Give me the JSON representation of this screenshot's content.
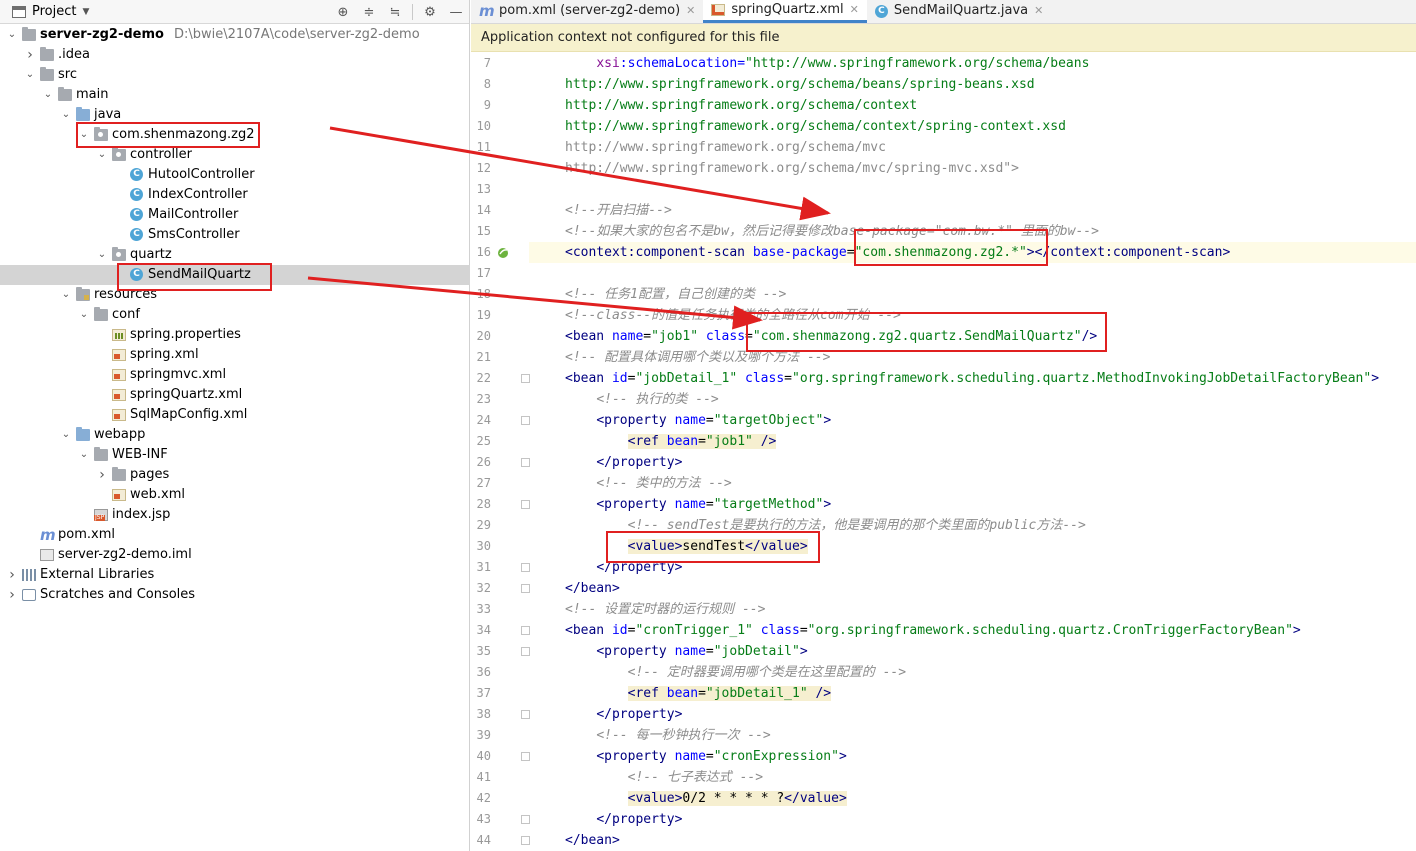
{
  "project_panel": {
    "title": "Project",
    "tools": [
      "target-icon",
      "collapse-icon",
      "expand-icon",
      "gear-icon",
      "hide-icon"
    ],
    "tree": [
      {
        "label": "server-zg2-demo",
        "path": "D:\\bwie\\2107A\\code\\server-zg2-demo",
        "indent": 0,
        "arrow": "down",
        "icon": "module",
        "bold": true
      },
      {
        "label": ".idea",
        "indent": 1,
        "arrow": "right",
        "icon": "folder"
      },
      {
        "label": "src",
        "indent": 1,
        "arrow": "down",
        "icon": "folder"
      },
      {
        "label": "main",
        "indent": 2,
        "arrow": "down",
        "icon": "folder"
      },
      {
        "label": "java",
        "indent": 3,
        "arrow": "down",
        "icon": "folder-blue"
      },
      {
        "label": "com.shenmazong.zg2",
        "indent": 4,
        "arrow": "down",
        "icon": "package"
      },
      {
        "label": "controller",
        "indent": 5,
        "arrow": "down",
        "icon": "package"
      },
      {
        "label": "HutoolController",
        "indent": 6,
        "arrow": "",
        "icon": "class"
      },
      {
        "label": "IndexController",
        "indent": 6,
        "arrow": "",
        "icon": "class"
      },
      {
        "label": "MailController",
        "indent": 6,
        "arrow": "",
        "icon": "class"
      },
      {
        "label": "SmsController",
        "indent": 6,
        "arrow": "",
        "icon": "class"
      },
      {
        "label": "quartz",
        "indent": 5,
        "arrow": "down",
        "icon": "package"
      },
      {
        "label": "SendMailQuartz",
        "indent": 6,
        "arrow": "",
        "icon": "class",
        "selected": true
      },
      {
        "label": "resources",
        "indent": 3,
        "arrow": "down",
        "icon": "folder-res"
      },
      {
        "label": "conf",
        "indent": 4,
        "arrow": "down",
        "icon": "folder"
      },
      {
        "label": "spring.properties",
        "indent": 5,
        "arrow": "",
        "icon": "props"
      },
      {
        "label": "spring.xml",
        "indent": 5,
        "arrow": "",
        "icon": "xml"
      },
      {
        "label": "springmvc.xml",
        "indent": 5,
        "arrow": "",
        "icon": "xml"
      },
      {
        "label": "springQuartz.xml",
        "indent": 5,
        "arrow": "",
        "icon": "xml"
      },
      {
        "label": "SqlMapConfig.xml",
        "indent": 5,
        "arrow": "",
        "icon": "xml"
      },
      {
        "label": "webapp",
        "indent": 3,
        "arrow": "down",
        "icon": "folder-blue"
      },
      {
        "label": "WEB-INF",
        "indent": 4,
        "arrow": "down",
        "icon": "folder"
      },
      {
        "label": "pages",
        "indent": 5,
        "arrow": "right",
        "icon": "folder"
      },
      {
        "label": "web.xml",
        "indent": 5,
        "arrow": "",
        "icon": "xml"
      },
      {
        "label": "index.jsp",
        "indent": 4,
        "arrow": "",
        "icon": "jsp"
      },
      {
        "label": "pom.xml",
        "indent": 1,
        "arrow": "",
        "icon": "maven"
      },
      {
        "label": "server-zg2-demo.iml",
        "indent": 1,
        "arrow": "",
        "icon": "iml"
      },
      {
        "label": "External Libraries",
        "indent": 0,
        "arrow": "right",
        "icon": "lib"
      },
      {
        "label": "Scratches and Consoles",
        "indent": 0,
        "arrow": "right",
        "icon": "scratch"
      }
    ]
  },
  "editor": {
    "tabs": [
      {
        "label": "pom.xml (server-zg2-demo)",
        "icon": "maven",
        "active": false
      },
      {
        "label": "springQuartz.xml",
        "icon": "xml",
        "active": true
      },
      {
        "label": "SendMailQuartz.java",
        "icon": "class",
        "active": false
      }
    ],
    "notice": "Application context not configured for this file",
    "current_line": 16,
    "lines": [
      {
        "n": 7,
        "tokens": [
          [
            "plain",
            "    "
          ],
          [
            "ns",
            "xsi"
          ],
          [
            "attr",
            ":schemaLocation="
          ],
          [
            "val",
            "\"http://www.springframework.org/schema/beans"
          ]
        ]
      },
      {
        "n": 8,
        "tokens": [
          [
            "url",
            "http://www.springframework.org/schema/beans/spring-beans.xsd"
          ]
        ]
      },
      {
        "n": 9,
        "tokens": [
          [
            "url",
            "http://www.springframework.org/schema/context"
          ]
        ]
      },
      {
        "n": 10,
        "tokens": [
          [
            "url",
            "http://www.springframework.org/schema/context/spring-context.xsd"
          ]
        ]
      },
      {
        "n": 11,
        "tokens": [
          [
            "gray",
            "http://www.springframework.org/schema/mvc"
          ]
        ]
      },
      {
        "n": 12,
        "tokens": [
          [
            "gray",
            "http://www.springframework.org/schema/mvc/spring-mvc.xsd\">"
          ]
        ]
      },
      {
        "n": 13,
        "tokens": []
      },
      {
        "n": 14,
        "tokens": [
          [
            "cm",
            "<!--开启扫描-->"
          ]
        ]
      },
      {
        "n": 15,
        "tokens": [
          [
            "cm",
            "<!--如果大家的包名不是bw，然后记得要修改base-package=\"com.bw.*\" 里面的bw-->"
          ]
        ]
      },
      {
        "n": 16,
        "tokens": [
          [
            "tag",
            "<context:component-scan "
          ],
          [
            "attr",
            "base-package"
          ],
          [
            "plain",
            "="
          ],
          [
            "val",
            "\"com.shenmazong.zg2.*\""
          ],
          [
            "tag",
            ">"
          ],
          [
            "tag",
            "</context:component-scan>"
          ]
        ]
      },
      {
        "n": 17,
        "tokens": []
      },
      {
        "n": 18,
        "tokens": [
          [
            "cm",
            "<!-- 任务1配置，自己创建的类 -->"
          ]
        ]
      },
      {
        "n": 19,
        "tokens": [
          [
            "cm",
            "<!--class--的值是任务执行类的全路径从com开始 -->"
          ]
        ]
      },
      {
        "n": 20,
        "tokens": [
          [
            "tag",
            "<bean "
          ],
          [
            "attr",
            "name"
          ],
          [
            "plain",
            "="
          ],
          [
            "val",
            "\"job1\""
          ],
          [
            "plain",
            " "
          ],
          [
            "attr",
            "class"
          ],
          [
            "plain",
            "="
          ],
          [
            "val",
            "\"com.shenmazong.zg2.quartz.SendMailQuartz\""
          ],
          [
            "tag",
            "/>"
          ]
        ]
      },
      {
        "n": 21,
        "tokens": [
          [
            "cm",
            "<!-- 配置具体调用哪个类以及哪个方法 -->"
          ]
        ]
      },
      {
        "n": 22,
        "tokens": [
          [
            "tag",
            "<bean "
          ],
          [
            "attr",
            "id"
          ],
          [
            "plain",
            "="
          ],
          [
            "val",
            "\"jobDetail_1\""
          ],
          [
            "plain",
            " "
          ],
          [
            "attr",
            "class"
          ],
          [
            "plain",
            "="
          ],
          [
            "val",
            "\"org.springframework.scheduling.quartz.MethodInvokingJobDetailFactoryBean\""
          ],
          [
            "tag",
            ">"
          ]
        ]
      },
      {
        "n": 23,
        "tokens": [
          [
            "plain",
            "    "
          ],
          [
            "cm",
            "<!-- 执行的类 -->"
          ]
        ]
      },
      {
        "n": 24,
        "tokens": [
          [
            "plain",
            "    "
          ],
          [
            "tag",
            "<property "
          ],
          [
            "attr",
            "name"
          ],
          [
            "plain",
            "="
          ],
          [
            "val",
            "\"targetObject\""
          ],
          [
            "tag",
            ">"
          ]
        ]
      },
      {
        "n": 25,
        "tokens": [
          [
            "plain",
            "        "
          ],
          [
            "hltag",
            "<ref "
          ],
          [
            "hlattr",
            "bean"
          ],
          [
            "hlplain",
            "="
          ],
          [
            "hlval",
            "\"job1\""
          ],
          [
            "hlplain",
            " "
          ],
          [
            "hltag",
            "/>"
          ]
        ]
      },
      {
        "n": 26,
        "tokens": [
          [
            "plain",
            "    "
          ],
          [
            "tag",
            "</property>"
          ]
        ]
      },
      {
        "n": 27,
        "tokens": [
          [
            "plain",
            "    "
          ],
          [
            "cm",
            "<!-- 类中的方法 -->"
          ]
        ]
      },
      {
        "n": 28,
        "tokens": [
          [
            "plain",
            "    "
          ],
          [
            "tag",
            "<property "
          ],
          [
            "attr",
            "name"
          ],
          [
            "plain",
            "="
          ],
          [
            "val",
            "\"targetMethod\""
          ],
          [
            "tag",
            ">"
          ]
        ]
      },
      {
        "n": 29,
        "tokens": [
          [
            "plain",
            "        "
          ],
          [
            "cm",
            "<!-- sendTest是要执行的方法，他是要调用的那个类里面的public方法-->"
          ]
        ]
      },
      {
        "n": 30,
        "tokens": [
          [
            "plain",
            "        "
          ],
          [
            "hltag",
            "<value>"
          ],
          [
            "hlplain",
            "sendTest"
          ],
          [
            "hltag",
            "</value>"
          ]
        ]
      },
      {
        "n": 31,
        "tokens": [
          [
            "plain",
            "    "
          ],
          [
            "tag",
            "</property>"
          ]
        ]
      },
      {
        "n": 32,
        "tokens": [
          [
            "tag",
            "</bean>"
          ]
        ]
      },
      {
        "n": 33,
        "tokens": [
          [
            "cm",
            "<!-- 设置定时器的运行规则 -->"
          ]
        ]
      },
      {
        "n": 34,
        "tokens": [
          [
            "tag",
            "<bean "
          ],
          [
            "attr",
            "id"
          ],
          [
            "plain",
            "="
          ],
          [
            "val",
            "\"cronTrigger_1\""
          ],
          [
            "plain",
            " "
          ],
          [
            "attr",
            "class"
          ],
          [
            "plain",
            "="
          ],
          [
            "val",
            "\"org.springframework.scheduling.quartz.CronTriggerFactoryBean\""
          ],
          [
            "tag",
            ">"
          ]
        ]
      },
      {
        "n": 35,
        "tokens": [
          [
            "plain",
            "    "
          ],
          [
            "tag",
            "<property "
          ],
          [
            "attr",
            "name"
          ],
          [
            "plain",
            "="
          ],
          [
            "val",
            "\"jobDetail\""
          ],
          [
            "tag",
            ">"
          ]
        ]
      },
      {
        "n": 36,
        "tokens": [
          [
            "plain",
            "        "
          ],
          [
            "cm",
            "<!-- 定时器要调用哪个类是在这里配置的 -->"
          ]
        ]
      },
      {
        "n": 37,
        "tokens": [
          [
            "plain",
            "        "
          ],
          [
            "hltag",
            "<ref "
          ],
          [
            "hlattr",
            "bean"
          ],
          [
            "hlplain",
            "="
          ],
          [
            "hlval",
            "\"jobDetail_1\""
          ],
          [
            "hlplain",
            " "
          ],
          [
            "hltag",
            "/>"
          ]
        ]
      },
      {
        "n": 38,
        "tokens": [
          [
            "plain",
            "    "
          ],
          [
            "tag",
            "</property>"
          ]
        ]
      },
      {
        "n": 39,
        "tokens": [
          [
            "plain",
            "    "
          ],
          [
            "cm",
            "<!-- 每一秒钟执行一次 -->"
          ]
        ]
      },
      {
        "n": 40,
        "tokens": [
          [
            "plain",
            "    "
          ],
          [
            "tag",
            "<property "
          ],
          [
            "attr",
            "name"
          ],
          [
            "plain",
            "="
          ],
          [
            "val",
            "\"cronExpression\""
          ],
          [
            "tag",
            ">"
          ]
        ]
      },
      {
        "n": 41,
        "tokens": [
          [
            "plain",
            "        "
          ],
          [
            "cm",
            "<!-- 七子表达式 -->"
          ]
        ]
      },
      {
        "n": 42,
        "tokens": [
          [
            "plain",
            "        "
          ],
          [
            "hltag",
            "<value>"
          ],
          [
            "hlplain",
            "0/2 * * * * ?"
          ],
          [
            "hltag",
            "</value>"
          ]
        ]
      },
      {
        "n": 43,
        "tokens": [
          [
            "plain",
            "    "
          ],
          [
            "tag",
            "</property>"
          ]
        ]
      },
      {
        "n": 44,
        "tokens": [
          [
            "tag",
            "</bean>"
          ]
        ]
      }
    ]
  },
  "colors": {
    "annotation": "#e02020",
    "tag": "#000080",
    "attr": "#0000ff",
    "value": "#067d17",
    "comment": "#8c8c8c",
    "notice_bg": "#f6f1cd",
    "selection": "#d4d4d4",
    "tab_accent": "#4083c9"
  }
}
